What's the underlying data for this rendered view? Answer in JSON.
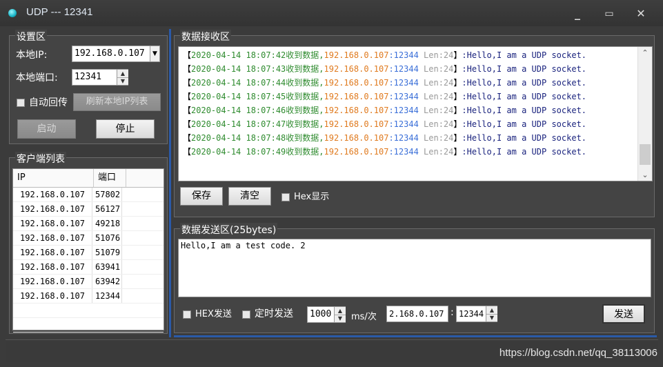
{
  "window": {
    "title": "UDP --- 12341",
    "min_glyph": "_",
    "max_glyph": "▭",
    "close_glyph": "✕"
  },
  "settings": {
    "legend": "设置区",
    "local_ip_label": "本地IP:",
    "local_ip_value": "192.168.0.107",
    "local_port_label": "本地端口:",
    "local_port_value": "12341",
    "auto_reply_label": "自动回传",
    "refresh_label": "刷新本地IP列表",
    "start_label": "启动",
    "stop_label": "停止"
  },
  "clients": {
    "legend": "客户端列表",
    "headers": [
      "IP",
      "端口"
    ],
    "rows": [
      [
        "192.168.0.107",
        "57802"
      ],
      [
        "192.168.0.107",
        "56127"
      ],
      [
        "192.168.0.107",
        "49218"
      ],
      [
        "192.168.0.107",
        "51076"
      ],
      [
        "192.168.0.107",
        "51079"
      ],
      [
        "192.168.0.107",
        "63941"
      ],
      [
        "192.168.0.107",
        "63942"
      ],
      [
        "192.168.0.107",
        "12344"
      ]
    ]
  },
  "receive": {
    "legend": "数据接收区",
    "lines": [
      {
        "open": "【",
        "time": "2020-04-14 18:07:42",
        "recv": "收到数据,",
        "ip": "192.168.0.107",
        "port": ":12344",
        "len": " Len:24",
        "close": "】",
        "msg": ":Hello,I am a UDP socket."
      },
      {
        "open": "【",
        "time": "2020-04-14 18:07:43",
        "recv": "收到数据,",
        "ip": "192.168.0.107",
        "port": ":12344",
        "len": " Len:24",
        "close": "】",
        "msg": ":Hello,I am a UDP socket."
      },
      {
        "open": "【",
        "time": "2020-04-14 18:07:44",
        "recv": "收到数据,",
        "ip": "192.168.0.107",
        "port": ":12344",
        "len": " Len:24",
        "close": "】",
        "msg": ":Hello,I am a UDP socket."
      },
      {
        "open": "【",
        "time": "2020-04-14 18:07:45",
        "recv": "收到数据,",
        "ip": "192.168.0.107",
        "port": ":12344",
        "len": " Len:24",
        "close": "】",
        "msg": ":Hello,I am a UDP socket."
      },
      {
        "open": "【",
        "time": "2020-04-14 18:07:46",
        "recv": "收到数据,",
        "ip": "192.168.0.107",
        "port": ":12344",
        "len": " Len:24",
        "close": "】",
        "msg": ":Hello,I am a UDP socket."
      },
      {
        "open": "【",
        "time": "2020-04-14 18:07:47",
        "recv": "收到数据,",
        "ip": "192.168.0.107",
        "port": ":12344",
        "len": " Len:24",
        "close": "】",
        "msg": ":Hello,I am a UDP socket."
      },
      {
        "open": "【",
        "time": "2020-04-14 18:07:48",
        "recv": "收到数据,",
        "ip": "192.168.0.107",
        "port": ":12344",
        "len": " Len:24",
        "close": "】",
        "msg": ":Hello,I am a UDP socket."
      },
      {
        "open": "【",
        "time": "2020-04-14 18:07:49",
        "recv": "收到数据,",
        "ip": "192.168.0.107",
        "port": ":12344",
        "len": " Len:24",
        "close": "】",
        "msg": ":Hello,I am a UDP socket."
      }
    ],
    "save_label": "保存",
    "clear_label": "清空",
    "hex_display_label": "Hex显示",
    "colors": {
      "time": "#2e8b2e",
      "ip": "#e07a1e",
      "port": "#3a6fd8",
      "len": "#999999",
      "msg": "#1a237e"
    }
  },
  "send": {
    "legend": "数据发送区(25bytes)",
    "text": "Hello,I am a test code. 2",
    "hex_send_label": "HEX发送",
    "timed_send_label": "定时发送",
    "interval_value": "1000",
    "interval_unit": "ms/次",
    "target_ip": "2.168.0.107",
    "target_port": "12344",
    "send_label": "发送"
  },
  "watermark": "https://blog.csdn.net/qq_38113006"
}
